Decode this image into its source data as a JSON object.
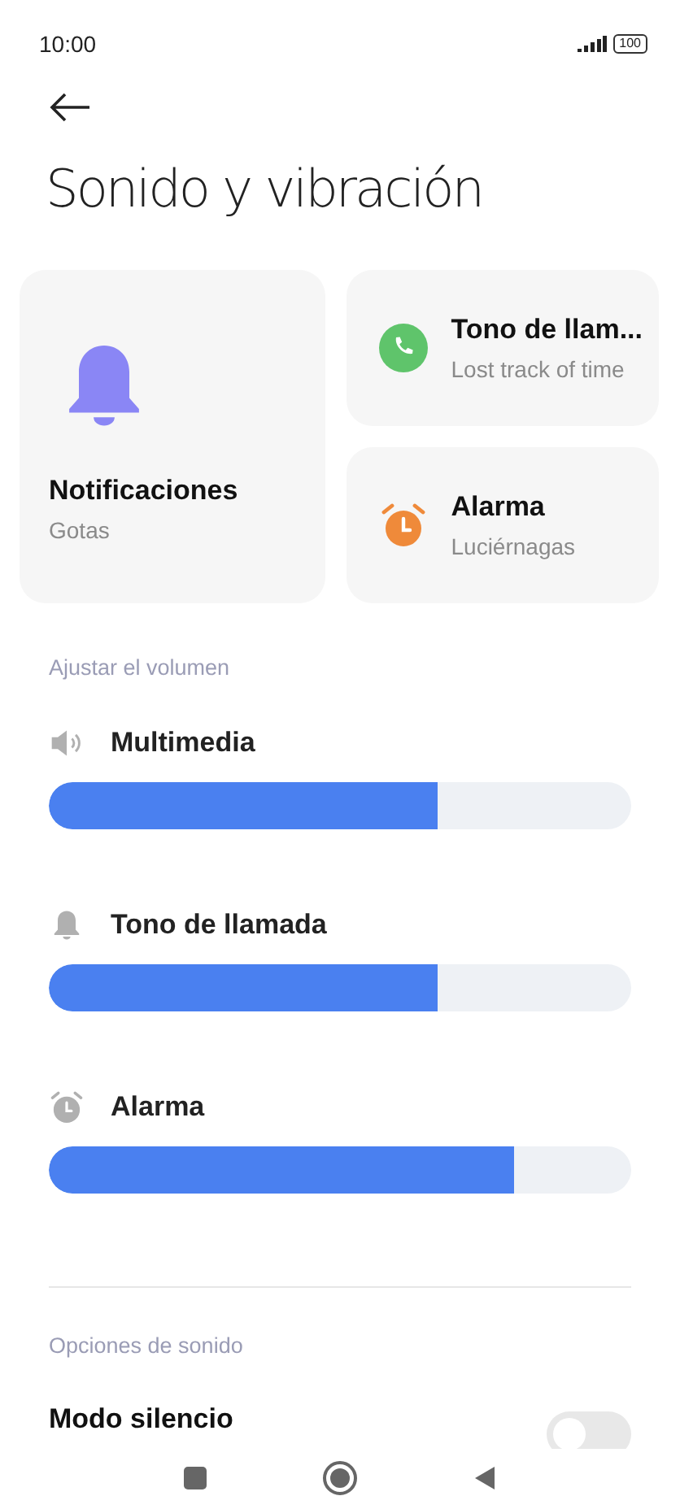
{
  "status_bar": {
    "time": "10:00",
    "battery": "100"
  },
  "page": {
    "title": "Sonido y vibración"
  },
  "tiles": [
    {
      "kind": "large",
      "title": "Notificaciones",
      "subtitle": "Gotas"
    },
    {
      "kind": "small",
      "title": "Tono de llam...",
      "subtitle": "Lost track of time"
    },
    {
      "kind": "small",
      "title": "Alarma",
      "subtitle": "Luciérnagas"
    }
  ],
  "volume_section": {
    "heading": "Ajustar el volumen",
    "sliders": [
      {
        "label": "Multimedia",
        "level": 0.667
      },
      {
        "label": "Tono de llamada",
        "level": 0.667
      },
      {
        "label": "Alarma",
        "level": 0.8
      }
    ]
  },
  "options_section": {
    "heading": "Opciones de sonido",
    "items": [
      {
        "label": "Modo silencio",
        "on": false
      }
    ]
  }
}
